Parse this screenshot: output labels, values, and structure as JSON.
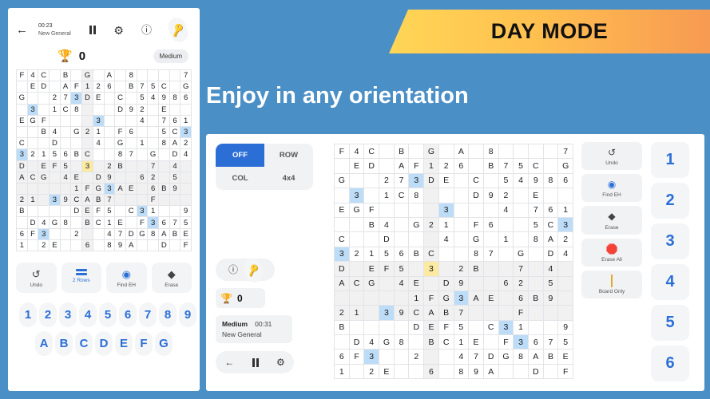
{
  "banner": {
    "text": "DAY MODE"
  },
  "headline": {
    "text": "Enjoy in any orientation"
  },
  "phone": {
    "header": {
      "back_icon": "arrow-left",
      "timer": "00:23",
      "subtitle": "New General",
      "pause_icon": "pause",
      "settings_icon": "gear",
      "info_icon": "info",
      "hint_icon": "key"
    },
    "score": {
      "trophy": "🏆",
      "value": "0",
      "difficulty": "Medium"
    },
    "actions": [
      {
        "icon": "undo",
        "label": "Undo"
      },
      {
        "icon": "rows",
        "label": "2 Rows"
      },
      {
        "icon": "find",
        "label": "Find EH"
      },
      {
        "icon": "erase",
        "label": "Erase"
      }
    ],
    "pad_row1": [
      "1",
      "2",
      "3",
      "4",
      "5",
      "6",
      "7",
      "8",
      "9"
    ],
    "pad_row2": [
      "A",
      "B",
      "C",
      "D",
      "E",
      "F",
      "G"
    ]
  },
  "tablet": {
    "modepad": [
      {
        "label": "OFF",
        "active": true
      },
      {
        "label": "ROW",
        "active": false
      },
      {
        "label": "COL",
        "active": false
      },
      {
        "label": "4x4",
        "active": false
      }
    ],
    "info_icon": "info",
    "hint_icon": "key",
    "score": {
      "trophy": "🏆",
      "value": "0"
    },
    "meta": {
      "difficulty": "Medium",
      "timer": "00:31",
      "subtitle": "New General"
    },
    "nav": {
      "back_icon": "arrow-left",
      "pause_icon": "pause",
      "settings_icon": "gear"
    },
    "actions": [
      {
        "icon": "undo",
        "label": "Undo"
      },
      {
        "icon": "find",
        "label": "Find EH"
      },
      {
        "icon": "erase",
        "label": "Erase"
      },
      {
        "icon": "erase-all",
        "label": "Erase All"
      },
      {
        "icon": "board",
        "label": "Board Only"
      }
    ],
    "numbers": [
      "1",
      "2",
      "3",
      "4",
      "5",
      "6"
    ]
  },
  "colors": {
    "page_background": "#4b8fc7",
    "accent_blue": "#2b6fd6",
    "selected_cell": "#bcdcf7",
    "current_cell": "#fbeaa0",
    "shaded_cell": "#f1f1f1",
    "banner_gradient_start": "#ffd657",
    "banner_gradient_end": "#f79a52"
  },
  "board": {
    "size": 16,
    "shaded_columns": [
      6
    ],
    "shaded_rows": [
      8,
      9,
      10,
      11
    ],
    "cells": [
      [
        "F",
        "4",
        "C",
        "",
        "B",
        "",
        "G",
        "",
        "A",
        "",
        "8",
        "",
        "",
        "",
        "",
        "7"
      ],
      [
        "",
        "E",
        "D",
        "",
        "A",
        "F",
        "1",
        "2",
        "6",
        "",
        "B",
        "7",
        "5",
        "C",
        "",
        "G"
      ],
      [
        "G",
        "",
        "",
        "2",
        "7",
        "3",
        "D",
        "E",
        "",
        "C",
        "",
        "5",
        "4",
        "9",
        "8",
        "6"
      ],
      [
        "",
        "3",
        "",
        "1",
        "C",
        "8",
        "",
        "",
        "",
        "D",
        "9",
        "2",
        "",
        "E",
        "",
        ""
      ],
      [
        "E",
        "G",
        "F",
        "",
        "",
        "",
        "",
        "3",
        "",
        "",
        "",
        "4",
        "",
        "7",
        "6",
        "1"
      ],
      [
        "",
        "",
        "B",
        "4",
        "",
        "G",
        "2",
        "1",
        "",
        "F",
        "6",
        "",
        "",
        "5",
        "C",
        "3"
      ],
      [
        "C",
        "",
        "",
        "D",
        "",
        "",
        "",
        "4",
        "",
        "G",
        "",
        "1",
        "",
        "8",
        "A",
        "2"
      ],
      [
        "3",
        "2",
        "1",
        "5",
        "6",
        "B",
        "C",
        "",
        "",
        "8",
        "7",
        "",
        "G",
        "",
        "D",
        "4"
      ],
      [
        "D",
        "",
        "E",
        "F",
        "5",
        "",
        "3",
        "",
        "2",
        "B",
        "",
        "",
        "7",
        "",
        "4",
        ""
      ],
      [
        "A",
        "C",
        "G",
        "",
        "4",
        "E",
        "",
        "D",
        "9",
        "",
        "",
        "6",
        "2",
        "",
        "5",
        ""
      ],
      [
        "",
        "",
        "",
        "",
        "",
        "1",
        "F",
        "G",
        "3",
        "A",
        "E",
        "",
        "6",
        "B",
        "9",
        ""
      ],
      [
        "2",
        "1",
        "",
        "3",
        "9",
        "C",
        "A",
        "B",
        "7",
        "",
        "",
        "",
        "F",
        "",
        "",
        ""
      ],
      [
        "B",
        "",
        "",
        "",
        "",
        "D",
        "E",
        "F",
        "5",
        "",
        "C",
        "3",
        "1",
        "",
        "",
        "9"
      ],
      [
        "",
        "D",
        "4",
        "G",
        "8",
        "",
        "B",
        "C",
        "1",
        "E",
        "",
        "F",
        "3",
        "6",
        "7",
        "5"
      ],
      [
        "6",
        "F",
        "3",
        "",
        "",
        "2",
        "",
        "",
        "4",
        "7",
        "D",
        "G",
        "8",
        "A",
        "B",
        "E"
      ],
      [
        "1",
        "",
        "2",
        "E",
        "",
        "",
        "6",
        "",
        "8",
        "9",
        "A",
        "",
        "",
        "D",
        "",
        "F"
      ]
    ],
    "selected_cells": [
      [
        0,
        1,
        "-"
      ],
      [
        3,
        1,
        "3"
      ],
      [
        2,
        5,
        "3"
      ],
      [
        4,
        7,
        "3"
      ],
      [
        5,
        15,
        "3"
      ],
      [
        7,
        0,
        "3"
      ],
      [
        10,
        8,
        "3"
      ],
      [
        11,
        3,
        "3"
      ],
      [
        12,
        11,
        "3"
      ],
      [
        13,
        12,
        "3"
      ],
      [
        14,
        2,
        "3"
      ]
    ],
    "current_cell": [
      8,
      6,
      "3"
    ]
  }
}
